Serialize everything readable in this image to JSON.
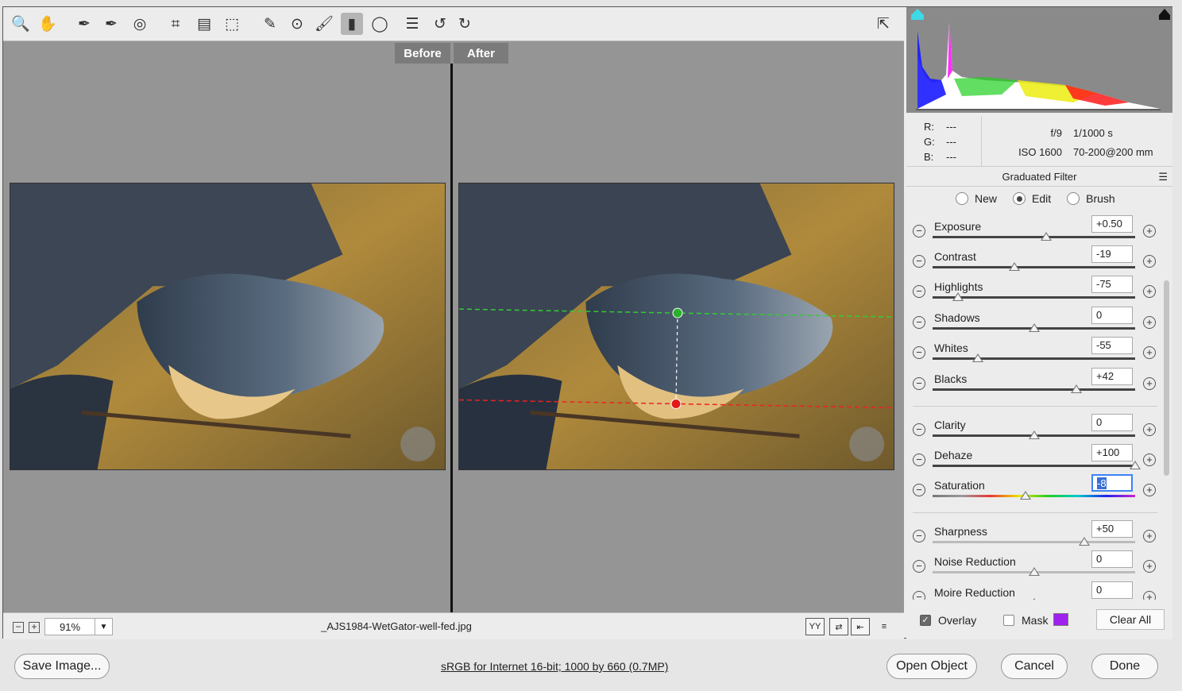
{
  "toolbar": {
    "tools": [
      {
        "name": "zoom-icon",
        "glyph": "🔍"
      },
      {
        "name": "hand-icon",
        "glyph": "✋"
      },
      {
        "name": "white-balance-icon",
        "glyph": "✒"
      },
      {
        "name": "color-sampler-icon",
        "glyph": "✒"
      },
      {
        "name": "targeted-adjustment-icon",
        "glyph": "◎"
      },
      {
        "name": "crop-icon",
        "glyph": "⌗"
      },
      {
        "name": "straighten-icon",
        "glyph": "▤"
      },
      {
        "name": "transform-icon",
        "glyph": "⬚"
      },
      {
        "name": "spot-removal-icon",
        "glyph": "✎"
      },
      {
        "name": "red-eye-icon",
        "glyph": "⊙"
      },
      {
        "name": "adjustment-brush-icon",
        "glyph": "🖌"
      },
      {
        "name": "graduated-filter-icon",
        "glyph": "▮"
      },
      {
        "name": "radial-filter-icon",
        "glyph": "◯"
      },
      {
        "name": "preferences-icon",
        "glyph": "☰"
      },
      {
        "name": "rotate-left-icon",
        "glyph": "↺"
      },
      {
        "name": "rotate-right-icon",
        "glyph": "↻"
      }
    ],
    "active_tool": "graduated-filter-icon",
    "fullscreen_icon": "fullscreen-toggle-icon"
  },
  "preview": {
    "before_label": "Before",
    "after_label": "After"
  },
  "status": {
    "zoom": "91%",
    "filename": "_AJS1984-WetGator-well-fed.jpg",
    "view_buttons": [
      "YY",
      "⇄",
      "⇤",
      "≡"
    ]
  },
  "info": {
    "r_label": "R:",
    "r_value": "---",
    "g_label": "G:",
    "g_value": "---",
    "b_label": "B:",
    "b_value": "---",
    "aperture": "f/9",
    "shutter": "1/1000 s",
    "iso": "ISO 1600",
    "lens": "70-200@200 mm"
  },
  "filter": {
    "title": "Graduated Filter",
    "modes": [
      {
        "label": "New",
        "selected": false
      },
      {
        "label": "Edit",
        "selected": true
      },
      {
        "label": "Brush",
        "selected": false
      }
    ]
  },
  "sliders": [
    {
      "label": "Exposure",
      "value": "+0.50",
      "pos": 0.56
    },
    {
      "label": "Contrast",
      "value": "-19",
      "pos": 0.405
    },
    {
      "label": "Highlights",
      "value": "-75",
      "pos": 0.125
    },
    {
      "label": "Shadows",
      "value": "0",
      "pos": 0.5
    },
    {
      "label": "Whites",
      "value": "-55",
      "pos": 0.225
    },
    {
      "label": "Blacks",
      "value": "+42",
      "pos": 0.71
    },
    {
      "label": "Clarity",
      "value": "0",
      "pos": 0.5
    },
    {
      "label": "Dehaze",
      "value": "+100",
      "pos": 1.0
    },
    {
      "label": "Saturation",
      "value": "-8",
      "pos": 0.46
    },
    {
      "label": "Sharpness",
      "value": "+50",
      "pos": 0.75
    },
    {
      "label": "Noise Reduction",
      "value": "0",
      "pos": 0.5
    },
    {
      "label": "Moire Reduction",
      "value": "0",
      "pos": 0.5
    }
  ],
  "overlay": {
    "overlay_label": "Overlay",
    "overlay_checked": true,
    "mask_label": "Mask",
    "mask_checked": false,
    "mask_color": "#a020f0",
    "clear_all": "Clear All"
  },
  "footer": {
    "save": "Save Image...",
    "color_space": "sRGB for Internet 16-bit; 1000 by 660 (0.7MP)",
    "open": "Open Object",
    "cancel": "Cancel",
    "done": "Done"
  }
}
